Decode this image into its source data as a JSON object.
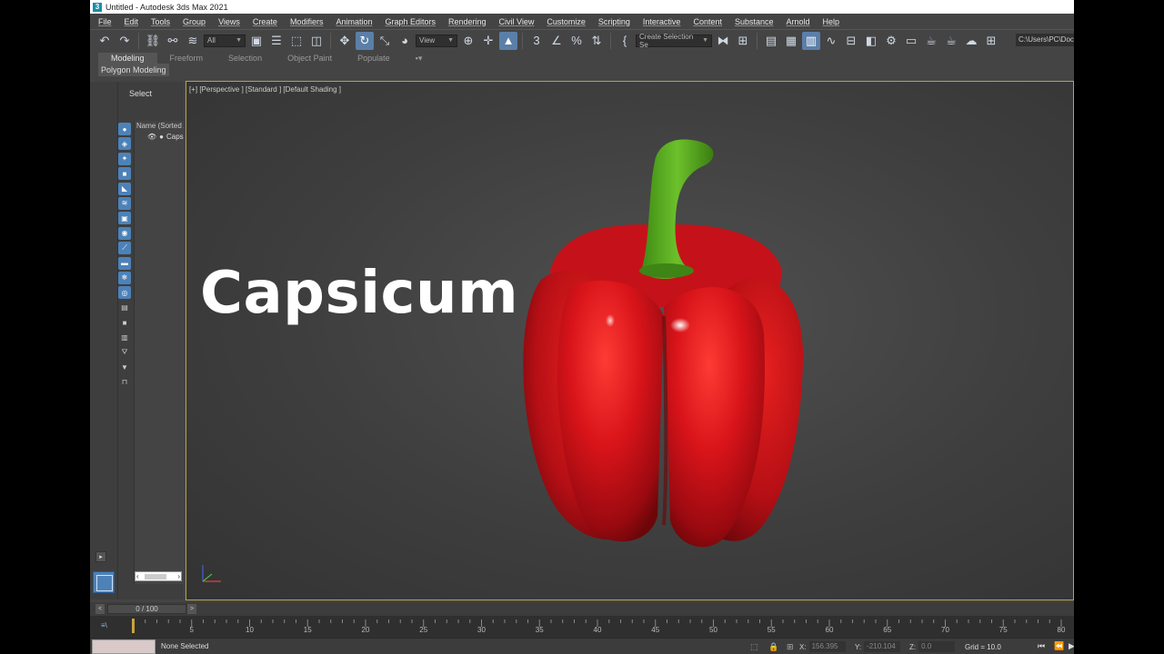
{
  "titlebar": {
    "app_icon": "3",
    "title": "Untitled - Autodesk 3ds Max 2021"
  },
  "menu": [
    "File",
    "Edit",
    "Tools",
    "Group",
    "Views",
    "Create",
    "Modifiers",
    "Animation",
    "Graph Editors",
    "Rendering",
    "Civil View",
    "Customize",
    "Scripting",
    "Interactive",
    "Content",
    "Substance",
    "Arnold",
    "Help"
  ],
  "toolbar": {
    "filter_value": "All",
    "ref_coord_value": "View",
    "selection_set_value": "Create Selection Se",
    "path_value": "C:\\Users\\PC\\Docu",
    "icons": [
      "undo-icon",
      "redo-icon",
      "link-icon",
      "unlink-icon",
      "bind-spacewarp-icon",
      "select-object-icon",
      "select-by-name-icon",
      "rect-region-icon",
      "window-crossing-icon",
      "move-icon",
      "rotate-icon",
      "scale-icon",
      "placement-icon",
      "pivot-icon",
      "snap-3d-icon",
      "angle-snap-icon",
      "percent-snap-icon",
      "spinner-snap-icon",
      "mirror-icon",
      "align-icon",
      "layer-explorer-icon",
      "toggle-ribbon-icon",
      "curve-editor-icon",
      "schematic-view-icon",
      "material-editor-icon",
      "render-setup-icon",
      "rendered-frame-icon",
      "render-icon"
    ]
  },
  "ribbon": {
    "tabs": [
      "Modeling",
      "Freeform",
      "Selection",
      "Object Paint",
      "Populate"
    ],
    "active_tab": "Modeling",
    "panel": "Polygon Modeling"
  },
  "scene_explorer": {
    "header": "Select",
    "column_header": "Name (Sorted Ascending)",
    "rows": [
      "Capsicum"
    ]
  },
  "viewport": {
    "label": "[+] [Perspective ] [Standard ] [Default Shading ]",
    "overlay_text": "Capsicum",
    "colors": {
      "pepper_red": "#d8141a",
      "stem_green": "#4fa51c",
      "border": "#b9a24a"
    }
  },
  "timeline": {
    "slider_text": "0 / 100",
    "prev": "<",
    "next": ">",
    "ticks": [
      "5",
      "10",
      "15",
      "20",
      "25",
      "30",
      "35",
      "40",
      "45",
      "50",
      "55",
      "60",
      "65",
      "70",
      "75",
      "80"
    ]
  },
  "status": {
    "selection": "None Selected",
    "x_label": "X:",
    "x_value": "156.395",
    "y_label": "Y:",
    "y_value": "-210.104",
    "z_label": "Z:",
    "z_value": "0.0",
    "grid": "Grid = 10.0"
  }
}
